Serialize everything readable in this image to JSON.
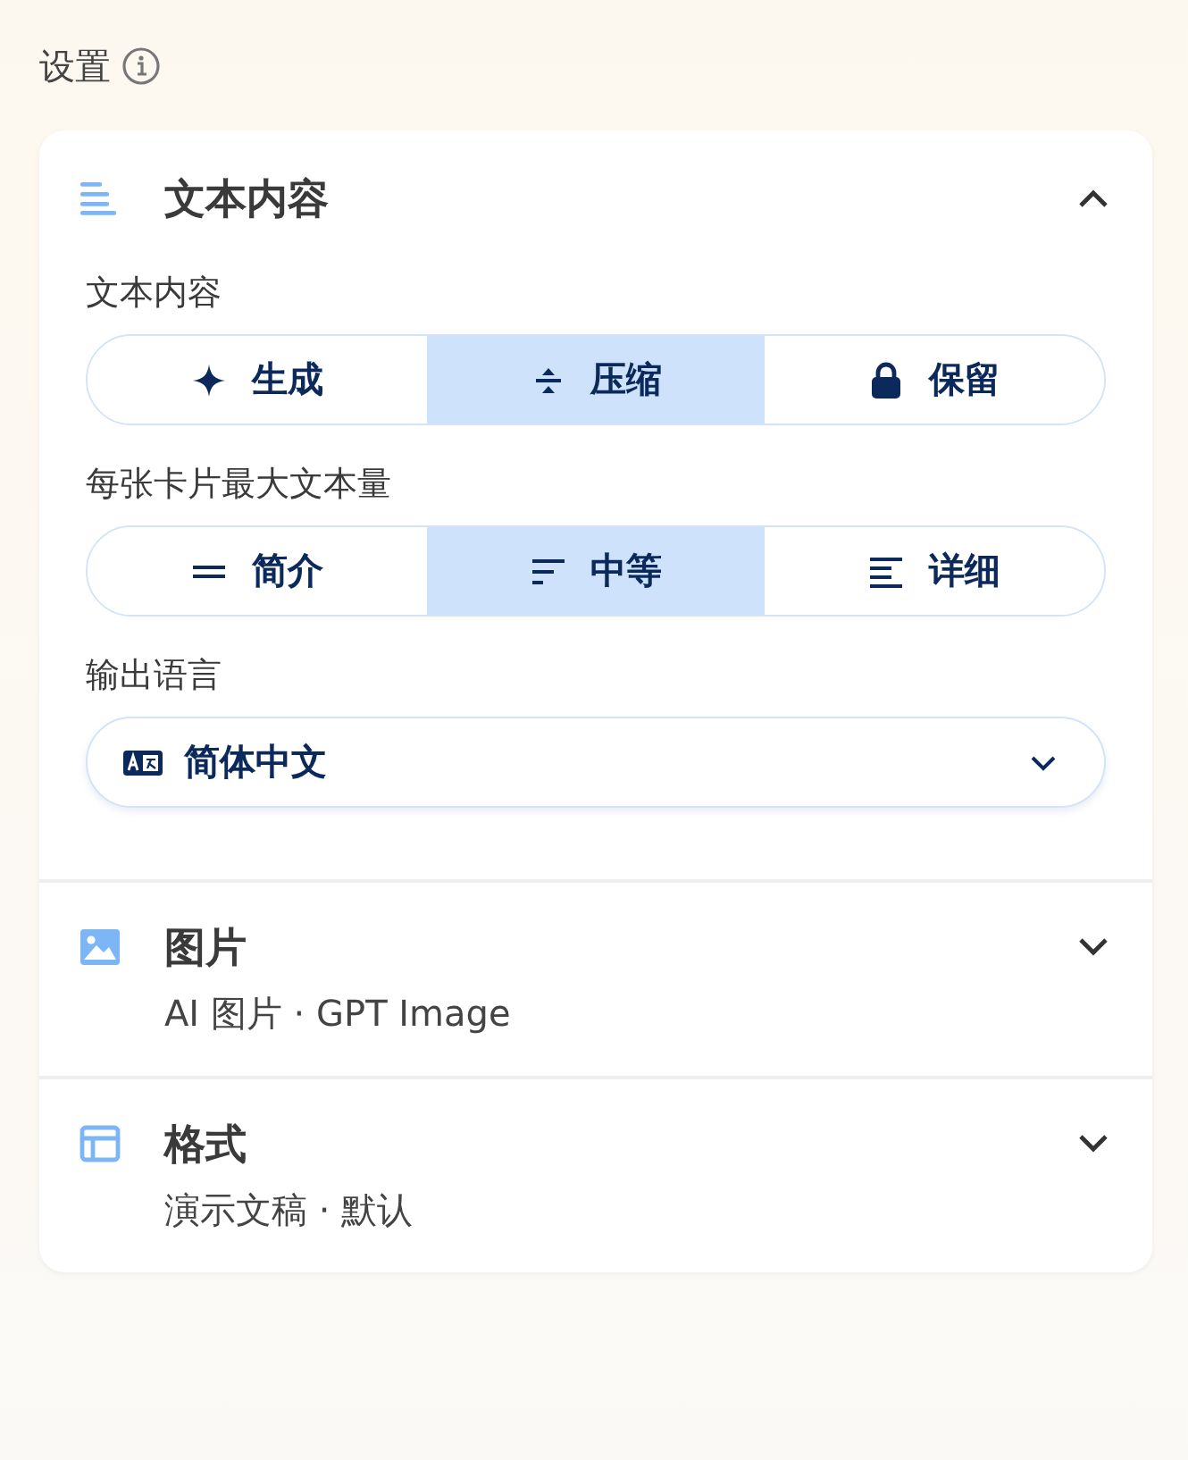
{
  "header": {
    "title": "设置"
  },
  "sections": [
    {
      "title": "文本内容",
      "expanded": true,
      "fields": [
        {
          "kind": "segmented",
          "label": "文本内容",
          "options": [
            {
              "label": "生成",
              "selected": false
            },
            {
              "label": "压缩",
              "selected": true
            },
            {
              "label": "保留",
              "selected": false
            }
          ]
        },
        {
          "kind": "segmented",
          "label": "每张卡片最大文本量",
          "options": [
            {
              "label": "简介",
              "selected": false
            },
            {
              "label": "中等",
              "selected": true
            },
            {
              "label": "详细",
              "selected": false
            }
          ]
        },
        {
          "kind": "dropdown",
          "label": "输出语言",
          "value": "简体中文"
        }
      ]
    },
    {
      "title": "图片",
      "expanded": false,
      "subtitle": "AI 图片 · GPT Image"
    },
    {
      "title": "格式",
      "expanded": false,
      "subtitle": "演示文稿 · 默认"
    }
  ]
}
